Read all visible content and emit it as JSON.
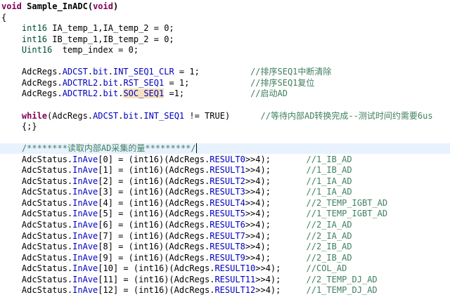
{
  "editor": {
    "lines": [
      {
        "tokens": [
          {
            "t": "void",
            "c": "kw"
          },
          {
            "t": " "
          },
          {
            "t": "Sample_InADC",
            "c": "fn"
          },
          {
            "t": "(",
            "c": "fn"
          },
          {
            "t": "void",
            "c": "kw"
          },
          {
            "t": ")",
            "c": "fn"
          }
        ]
      },
      {
        "tokens": [
          {
            "t": "{"
          }
        ]
      },
      {
        "tokens": [
          {
            "t": "    "
          },
          {
            "t": "int16",
            "c": "type"
          },
          {
            "t": " IA_temp_1,IA_temp_2 = 0;"
          }
        ]
      },
      {
        "tokens": [
          {
            "t": "    "
          },
          {
            "t": "int16",
            "c": "type"
          },
          {
            "t": " IB_temp_1,IB_temp_2 = 0;"
          }
        ]
      },
      {
        "tokens": [
          {
            "t": "    "
          },
          {
            "t": "Uint16",
            "c": "type"
          },
          {
            "t": "  temp_index = 0;"
          }
        ]
      },
      {
        "tokens": []
      },
      {
        "tokens": [
          {
            "t": "    AdcRegs."
          },
          {
            "t": "ADCST",
            "c": "field"
          },
          {
            "t": "."
          },
          {
            "t": "bit",
            "c": "field"
          },
          {
            "t": "."
          },
          {
            "t": "INT_SEQ1_CLR",
            "c": "field"
          },
          {
            "t": " = 1;          "
          },
          {
            "t": "//排序SEQ1中断清除",
            "c": "cmt"
          }
        ]
      },
      {
        "tokens": [
          {
            "t": "    AdcRegs."
          },
          {
            "t": "ADCTRL2",
            "c": "field"
          },
          {
            "t": "."
          },
          {
            "t": "bit",
            "c": "field"
          },
          {
            "t": "."
          },
          {
            "t": "RST_SEQ1",
            "c": "field"
          },
          {
            "t": " = 1;            "
          },
          {
            "t": "//排序SEQ1复位",
            "c": "cmt"
          }
        ]
      },
      {
        "tokens": [
          {
            "t": "    AdcRegs."
          },
          {
            "t": "ADCTRL2",
            "c": "field"
          },
          {
            "t": "."
          },
          {
            "t": "bit",
            "c": "field"
          },
          {
            "t": "."
          },
          {
            "t": "SOC_SEQ1",
            "c": "field mark"
          },
          {
            "t": " =1;             "
          },
          {
            "t": "//启动AD",
            "c": "cmt"
          }
        ]
      },
      {
        "tokens": []
      },
      {
        "tokens": [
          {
            "t": "    "
          },
          {
            "t": "while",
            "c": "kw"
          },
          {
            "t": "(AdcRegs."
          },
          {
            "t": "ADCST",
            "c": "field"
          },
          {
            "t": "."
          },
          {
            "t": "bit",
            "c": "field"
          },
          {
            "t": "."
          },
          {
            "t": "INT_SEQ1",
            "c": "field"
          },
          {
            "t": " != TRUE)      "
          },
          {
            "t": "//等待内部AD转换完成--测试时间约需要6us",
            "c": "cmt"
          }
        ]
      },
      {
        "tokens": [
          {
            "t": "    {;}"
          }
        ]
      },
      {
        "tokens": []
      },
      {
        "hl": true,
        "tokens": [
          {
            "t": "    "
          },
          {
            "t": "/********读取内部AD采集的量*********/",
            "c": "cmt cursor"
          }
        ]
      },
      {
        "tokens": [
          {
            "t": "    AdcStatus."
          },
          {
            "t": "InAve",
            "c": "field"
          },
          {
            "t": "[0] = (int16)(AdcRegs."
          },
          {
            "t": "RESULT0",
            "c": "field"
          },
          {
            "t": ">>4);       "
          },
          {
            "t": "//1_IB_AD",
            "c": "cmt"
          }
        ]
      },
      {
        "tokens": [
          {
            "t": "    AdcStatus."
          },
          {
            "t": "InAve",
            "c": "field"
          },
          {
            "t": "[1] = (int16)(AdcRegs."
          },
          {
            "t": "RESULT1",
            "c": "field"
          },
          {
            "t": ">>4);       "
          },
          {
            "t": "//1_IB_AD",
            "c": "cmt"
          }
        ]
      },
      {
        "tokens": [
          {
            "t": "    AdcStatus."
          },
          {
            "t": "InAve",
            "c": "field"
          },
          {
            "t": "[2] = (int16)(AdcRegs."
          },
          {
            "t": "RESULT2",
            "c": "field"
          },
          {
            "t": ">>4);       "
          },
          {
            "t": "//1_IA_AD",
            "c": "cmt"
          }
        ]
      },
      {
        "tokens": [
          {
            "t": "    AdcStatus."
          },
          {
            "t": "InAve",
            "c": "field"
          },
          {
            "t": "[3] = (int16)(AdcRegs."
          },
          {
            "t": "RESULT3",
            "c": "field"
          },
          {
            "t": ">>4);       "
          },
          {
            "t": "//1_IA_AD",
            "c": "cmt"
          }
        ]
      },
      {
        "tokens": [
          {
            "t": "    AdcStatus."
          },
          {
            "t": "InAve",
            "c": "field"
          },
          {
            "t": "[4] = (int16)(AdcRegs."
          },
          {
            "t": "RESULT4",
            "c": "field"
          },
          {
            "t": ">>4);       "
          },
          {
            "t": "//2_TEMP_IGBT_AD",
            "c": "cmt"
          }
        ]
      },
      {
        "tokens": [
          {
            "t": "    AdcStatus."
          },
          {
            "t": "InAve",
            "c": "field"
          },
          {
            "t": "[5] = (int16)(AdcRegs."
          },
          {
            "t": "RESULT5",
            "c": "field"
          },
          {
            "t": ">>4);       "
          },
          {
            "t": "//1_TEMP_IGBT_AD",
            "c": "cmt"
          }
        ]
      },
      {
        "tokens": [
          {
            "t": "    AdcStatus."
          },
          {
            "t": "InAve",
            "c": "field"
          },
          {
            "t": "[6] = (int16)(AdcRegs."
          },
          {
            "t": "RESULT6",
            "c": "field"
          },
          {
            "t": ">>4);       "
          },
          {
            "t": "//2_IA_AD",
            "c": "cmt"
          }
        ]
      },
      {
        "tokens": [
          {
            "t": "    AdcStatus."
          },
          {
            "t": "InAve",
            "c": "field"
          },
          {
            "t": "[7] = (int16)(AdcRegs."
          },
          {
            "t": "RESULT7",
            "c": "field"
          },
          {
            "t": ">>4);       "
          },
          {
            "t": "//2_IA_AD",
            "c": "cmt"
          }
        ]
      },
      {
        "tokens": [
          {
            "t": "    AdcStatus."
          },
          {
            "t": "InAve",
            "c": "field"
          },
          {
            "t": "[8] = (int16)(AdcRegs."
          },
          {
            "t": "RESULT8",
            "c": "field"
          },
          {
            "t": ">>4);       "
          },
          {
            "t": "//2_IB_AD",
            "c": "cmt"
          }
        ]
      },
      {
        "tokens": [
          {
            "t": "    AdcStatus."
          },
          {
            "t": "InAve",
            "c": "field"
          },
          {
            "t": "[9] = (int16)(AdcRegs."
          },
          {
            "t": "RESULT9",
            "c": "field"
          },
          {
            "t": ">>4);       "
          },
          {
            "t": "//2_IB_AD",
            "c": "cmt"
          }
        ]
      },
      {
        "tokens": [
          {
            "t": "    AdcStatus."
          },
          {
            "t": "InAve",
            "c": "field"
          },
          {
            "t": "[10] = (int16)(AdcRegs."
          },
          {
            "t": "RESULT10",
            "c": "field"
          },
          {
            "t": ">>4);     "
          },
          {
            "t": "//COL_AD",
            "c": "cmt"
          }
        ]
      },
      {
        "tokens": [
          {
            "t": "    AdcStatus."
          },
          {
            "t": "InAve",
            "c": "field"
          },
          {
            "t": "[11] = (int16)(AdcRegs."
          },
          {
            "t": "RESULT11",
            "c": "field"
          },
          {
            "t": ">>4);     "
          },
          {
            "t": "//2_TEMP_DJ_AD",
            "c": "cmt"
          }
        ]
      },
      {
        "tokens": [
          {
            "t": "    AdcStatus."
          },
          {
            "t": "InAve",
            "c": "field"
          },
          {
            "t": "[12] = (int16)(AdcRegs."
          },
          {
            "t": "RESULT12",
            "c": "field"
          },
          {
            "t": ">>4);     "
          },
          {
            "t": "//1_TEMP_DJ_AD",
            "c": "cmt"
          }
        ]
      }
    ]
  },
  "colors": {
    "keyword": "#7f0055",
    "type": "#005032",
    "field": "#0000c0",
    "comment": "#3f7f5f",
    "current_line": "#e8f2fe",
    "occurrence_mark": "#f4e1bd"
  }
}
